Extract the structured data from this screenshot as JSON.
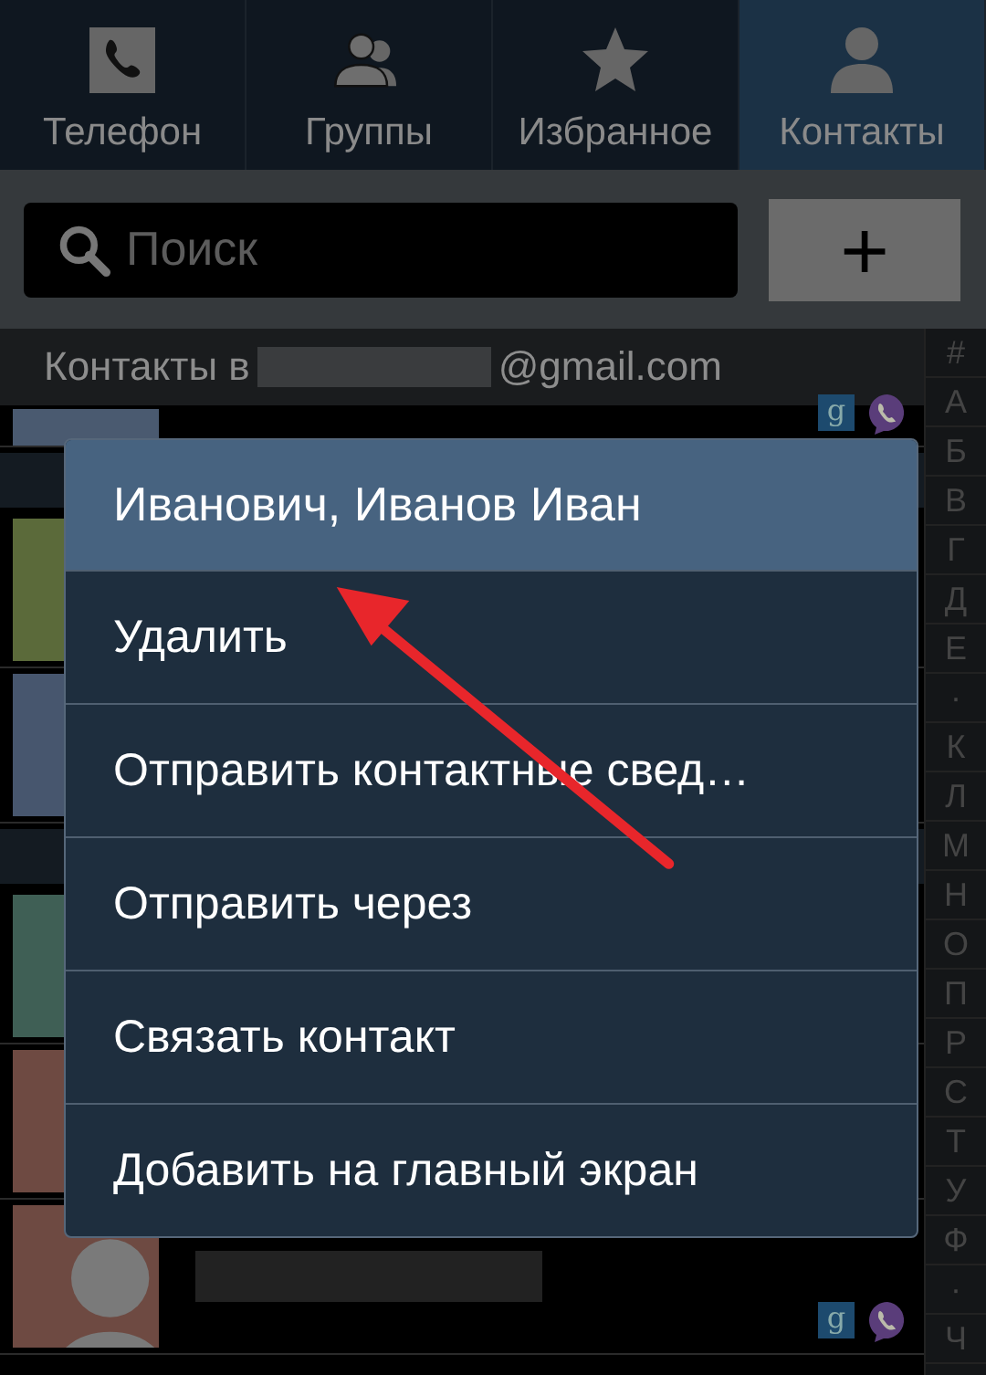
{
  "tabs": [
    {
      "label": "Телефон",
      "selected": false
    },
    {
      "label": "Группы",
      "selected": false
    },
    {
      "label": "Избранное",
      "selected": false
    },
    {
      "label": "Контакты",
      "selected": true
    }
  ],
  "search": {
    "placeholder": "Поиск"
  },
  "add_button": {
    "label": "+"
  },
  "account_header": {
    "prefix": "Контакты в",
    "suffix": "@gmail.com"
  },
  "contacts": [
    {
      "kind": "contact",
      "color": "#4a5a70",
      "badge": "g",
      "partial": true
    },
    {
      "kind": "section"
    },
    {
      "kind": "contact",
      "color": "#5b6a3a",
      "partial": false
    },
    {
      "kind": "contact",
      "color": "#47566e",
      "partial": false
    },
    {
      "kind": "section"
    },
    {
      "kind": "contact",
      "color": "#3f5f55",
      "partial": false
    },
    {
      "kind": "contact",
      "color": "#6e4a42",
      "partial": false
    },
    {
      "kind": "contact",
      "color": "#6e4a42",
      "badge": "g",
      "partial": false
    }
  ],
  "index": [
    "#",
    "А",
    "Б",
    "В",
    "Г",
    "Д",
    "Е",
    "·",
    "К",
    "Л",
    "М",
    "Н",
    "О",
    "П",
    "Р",
    "С",
    "Т",
    "У",
    "Ф",
    "·",
    "Ч"
  ],
  "menu": {
    "title": "Иванович, Иванов Иван",
    "items": [
      {
        "label": "Удалить",
        "pointed": true
      },
      {
        "label": "Отправить контактные свед…",
        "pointed": false
      },
      {
        "label": "Отправить через",
        "pointed": false
      },
      {
        "label": "Связать контакт",
        "pointed": false
      },
      {
        "label": "Добавить на главный экран",
        "pointed": false
      }
    ]
  }
}
